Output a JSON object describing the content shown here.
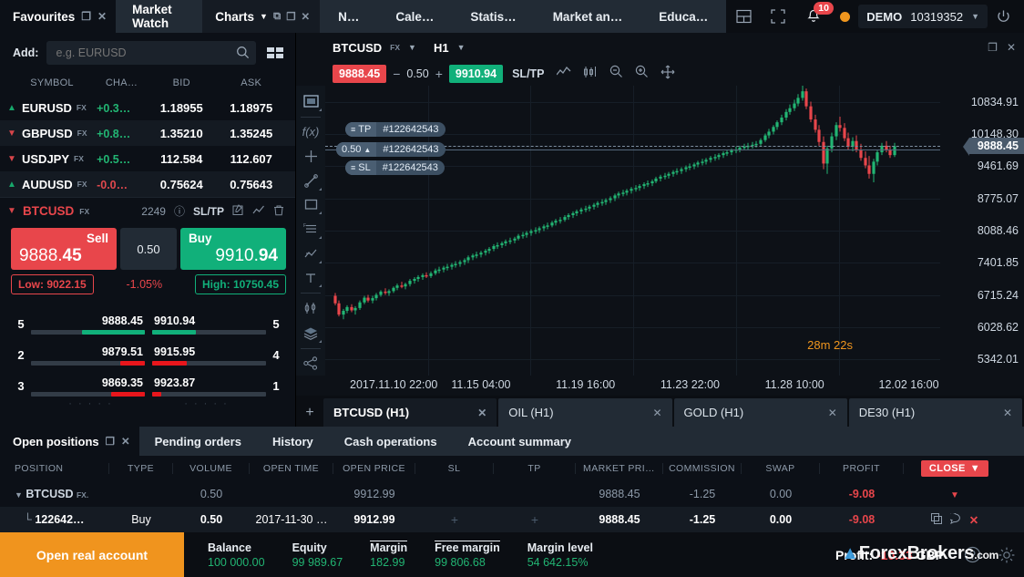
{
  "topbar": {
    "favourites_tab": "Favourites",
    "market_watch_tab": "Market Watch",
    "charts_tab": "Charts",
    "nav_tabs": [
      {
        "label": "N…"
      },
      {
        "label": "Cale…"
      },
      {
        "label": "Statis…"
      },
      {
        "label": "Market an…"
      },
      {
        "label": "Educa…"
      }
    ],
    "notification_count": "10",
    "account_type": "DEMO",
    "account_number": "10319352"
  },
  "watchlist": {
    "add_label": "Add:",
    "search_placeholder": "e.g. EURUSD",
    "columns": [
      "SYMBOL",
      "CHA…",
      "BID",
      "ASK"
    ],
    "rows": [
      {
        "dir": "up",
        "symbol": "EURUSD",
        "kind": "FX",
        "change": "+0.3…",
        "change_dir": "up",
        "bid": "1.18955",
        "ask": "1.18975"
      },
      {
        "dir": "down",
        "symbol": "GBPUSD",
        "kind": "FX",
        "change": "+0.8…",
        "change_dir": "up",
        "bid": "1.35210",
        "ask": "1.35245"
      },
      {
        "dir": "down",
        "symbol": "USDJPY",
        "kind": "FX",
        "change": "+0.5…",
        "change_dir": "up",
        "bid": "112.584",
        "ask": "112.607"
      },
      {
        "dir": "up",
        "symbol": "AUDUSD",
        "kind": "FX",
        "change": "-0.0…",
        "change_dir": "down",
        "bid": "0.75624",
        "ask": "0.75643"
      }
    ],
    "selected": {
      "symbol": "BTCUSD",
      "kind": "FX",
      "spread": "2249",
      "sltp": "SL/TP"
    }
  },
  "deal": {
    "sell_label": "Sell",
    "sell_price_main": "9888.",
    "sell_price_dec": "45",
    "volume": "0.50",
    "buy_label": "Buy",
    "buy_price_main": "9910.",
    "buy_price_dec": "94",
    "low": "Low: 9022.15",
    "change_pct": "-1.05%",
    "high": "High: 10750.45"
  },
  "depth": {
    "rows": [
      {
        "bid_qty": "5",
        "bid_price": "9888.45",
        "bid_pct": 55,
        "bid_color": "#11b07a",
        "ask_price": "9910.94",
        "ask_qty": "5",
        "ask_pct": 38,
        "ask_color": "#11b07a"
      },
      {
        "bid_qty": "2",
        "bid_price": "9879.51",
        "bid_pct": 22,
        "bid_color": "#e8161c",
        "ask_price": "9915.95",
        "ask_qty": "4",
        "ask_pct": 30,
        "ask_color": "#e8161c"
      },
      {
        "bid_qty": "3",
        "bid_price": "9869.35",
        "bid_pct": 30,
        "bid_color": "#e8161c",
        "ask_price": "9923.87",
        "ask_qty": "1",
        "ask_pct": 8,
        "ask_color": "#e8161c"
      }
    ]
  },
  "chart": {
    "symbol": "BTCUSD",
    "kind": "FX",
    "timeframe": "H1",
    "sell_price": "9888.45",
    "minus": "−",
    "volume": "0.50",
    "plus": "+",
    "buy_price": "9910.94",
    "sltp": "SL/TP",
    "countdown_m": "28m",
    "countdown_s": "22s",
    "countdown_m_unit": "m",
    "countdown_s_unit": "s",
    "position_tags": {
      "tp": "TP",
      "tp_id": "#122642543",
      "vol": "0.50",
      "vol_id": "#122642543",
      "sl": "SL",
      "sl_id": "#122642543"
    },
    "price_tag": "9888.45",
    "price_axis": [
      "10834.91",
      "10148.30",
      "9461.69",
      "8775.07",
      "8088.46",
      "7401.85",
      "6715.24",
      "6028.62",
      "5342.01"
    ],
    "time_axis": [
      "2017.11.10 22:00",
      "11.15 04:00",
      "11.19 16:00",
      "11.23 22:00",
      "11.28 10:00",
      "12.02 16:00"
    ],
    "tabs": [
      {
        "label": "BTCUSD (H1)",
        "active": true
      },
      {
        "label": "OIL (H1)",
        "active": false
      },
      {
        "label": "GOLD (H1)",
        "active": false
      },
      {
        "label": "DE30 (H1)",
        "active": false
      }
    ]
  },
  "chart_data": {
    "type": "candlestick",
    "title": "BTCUSD (H1)",
    "ylim": [
      5000,
      11180
    ],
    "up_color": "#22b573",
    "down_color": "#e8464b",
    "candles": [
      [
        0.01,
        6700,
        6760,
        6500,
        6540
      ],
      [
        0.017,
        6540,
        6600,
        6260,
        6300
      ],
      [
        0.024,
        6300,
        6420,
        6200,
        6380
      ],
      [
        0.031,
        6380,
        6500,
        6330,
        6460
      ],
      [
        0.038,
        6460,
        6520,
        6350,
        6390
      ],
      [
        0.045,
        6390,
        6480,
        6300,
        6440
      ],
      [
        0.052,
        6440,
        6600,
        6400,
        6560
      ],
      [
        0.059,
        6560,
        6700,
        6520,
        6660
      ],
      [
        0.066,
        6660,
        6720,
        6560,
        6600
      ],
      [
        0.073,
        6600,
        6700,
        6540,
        6650
      ],
      [
        0.08,
        6650,
        6760,
        6600,
        6720
      ],
      [
        0.087,
        6720,
        6820,
        6680,
        6790
      ],
      [
        0.094,
        6790,
        6860,
        6720,
        6760
      ],
      [
        0.101,
        6760,
        6840,
        6700,
        6800
      ],
      [
        0.108,
        6800,
        6900,
        6760,
        6870
      ],
      [
        0.115,
        6870,
        6960,
        6820,
        6920
      ],
      [
        0.122,
        6920,
        7000,
        6860,
        6900
      ],
      [
        0.129,
        6900,
        6980,
        6840,
        6950
      ],
      [
        0.136,
        6950,
        7060,
        6900,
        7020
      ],
      [
        0.143,
        7020,
        7100,
        6960,
        7060
      ],
      [
        0.15,
        7060,
        7140,
        7000,
        7100
      ],
      [
        0.157,
        7100,
        7180,
        7040,
        7140
      ],
      [
        0.164,
        7140,
        7200,
        7080,
        7120
      ],
      [
        0.171,
        7120,
        7220,
        7080,
        7180
      ],
      [
        0.178,
        7180,
        7280,
        7140,
        7240
      ],
      [
        0.185,
        7240,
        7320,
        7180,
        7260
      ],
      [
        0.192,
        7260,
        7340,
        7200,
        7300
      ],
      [
        0.199,
        7300,
        7380,
        7240,
        7320
      ],
      [
        0.206,
        7320,
        7400,
        7260,
        7360
      ],
      [
        0.213,
        7360,
        7440,
        7300,
        7380
      ],
      [
        0.22,
        7380,
        7460,
        7320,
        7420
      ],
      [
        0.227,
        7420,
        7500,
        7360,
        7460
      ],
      [
        0.234,
        7460,
        7560,
        7400,
        7520
      ],
      [
        0.241,
        7520,
        7600,
        7460,
        7560
      ],
      [
        0.248,
        7560,
        7640,
        7500,
        7580
      ],
      [
        0.255,
        7580,
        7660,
        7520,
        7620
      ],
      [
        0.262,
        7620,
        7700,
        7560,
        7660
      ],
      [
        0.269,
        7660,
        7740,
        7600,
        7700
      ],
      [
        0.276,
        7700,
        7800,
        7650,
        7760
      ],
      [
        0.283,
        7760,
        7840,
        7700,
        7780
      ],
      [
        0.29,
        7780,
        7860,
        7720,
        7820
      ],
      [
        0.297,
        7820,
        7900,
        7760,
        7860
      ],
      [
        0.304,
        7860,
        7940,
        7800,
        7880
      ],
      [
        0.311,
        7880,
        7960,
        7820,
        7920
      ],
      [
        0.318,
        7920,
        8020,
        7880,
        7980
      ],
      [
        0.325,
        7980,
        8060,
        7920,
        8000
      ],
      [
        0.332,
        8000,
        8080,
        7940,
        8040
      ],
      [
        0.339,
        8040,
        8120,
        7980,
        8080
      ],
      [
        0.346,
        8080,
        8160,
        8020,
        8100
      ],
      [
        0.353,
        8100,
        8180,
        8040,
        8140
      ],
      [
        0.36,
        8140,
        8220,
        8080,
        8180
      ],
      [
        0.367,
        8180,
        8260,
        8120,
        8200
      ],
      [
        0.374,
        8200,
        8300,
        8160,
        8260
      ],
      [
        0.381,
        8260,
        8340,
        8200,
        8300
      ],
      [
        0.388,
        8300,
        8380,
        8240,
        8320
      ],
      [
        0.395,
        8320,
        8420,
        8280,
        8380
      ],
      [
        0.402,
        8380,
        8460,
        8320,
        8420
      ],
      [
        0.409,
        8420,
        8500,
        8360,
        8460
      ],
      [
        0.416,
        8460,
        8540,
        8400,
        8500
      ],
      [
        0.423,
        8500,
        8580,
        8440,
        8540
      ],
      [
        0.43,
        8540,
        8620,
        8480,
        8560
      ],
      [
        0.437,
        8560,
        8640,
        8500,
        8600
      ],
      [
        0.444,
        8600,
        8680,
        8540,
        8640
      ],
      [
        0.451,
        8640,
        8720,
        8580,
        8680
      ],
      [
        0.458,
        8680,
        8760,
        8620,
        8700
      ],
      [
        0.465,
        8700,
        8780,
        8640,
        8740
      ],
      [
        0.472,
        8740,
        8820,
        8680,
        8780
      ],
      [
        0.479,
        8780,
        8880,
        8720,
        8840
      ],
      [
        0.486,
        8840,
        8920,
        8780,
        8880
      ],
      [
        0.493,
        8880,
        8960,
        8820,
        8900
      ],
      [
        0.5,
        8900,
        8980,
        8840,
        8940
      ],
      [
        0.507,
        8940,
        9020,
        8880,
        8980
      ],
      [
        0.514,
        8980,
        9060,
        8920,
        9000
      ],
      [
        0.521,
        9000,
        9080,
        8940,
        9040
      ],
      [
        0.528,
        9040,
        9120,
        8980,
        9080
      ],
      [
        0.535,
        9080,
        9160,
        9020,
        9100
      ],
      [
        0.542,
        9100,
        9180,
        9040,
        9140
      ],
      [
        0.549,
        9140,
        9240,
        9100,
        9200
      ],
      [
        0.556,
        9200,
        9280,
        9140,
        9240
      ],
      [
        0.563,
        9240,
        9320,
        9180,
        9260
      ],
      [
        0.57,
        9260,
        9340,
        9200,
        9300
      ],
      [
        0.577,
        9300,
        9380,
        9240,
        9340
      ],
      [
        0.584,
        9340,
        9420,
        9280,
        9360
      ],
      [
        0.591,
        9360,
        9440,
        9300,
        9400
      ],
      [
        0.598,
        9400,
        9480,
        9340,
        9440
      ],
      [
        0.605,
        9440,
        9520,
        9380,
        9460
      ],
      [
        0.612,
        9460,
        9540,
        9400,
        9500
      ],
      [
        0.619,
        9500,
        9580,
        9440,
        9540
      ],
      [
        0.626,
        9540,
        9620,
        9480,
        9560
      ],
      [
        0.633,
        9560,
        9640,
        9500,
        9600
      ],
      [
        0.64,
        9600,
        9680,
        9540,
        9640
      ],
      [
        0.647,
        9640,
        9720,
        9580,
        9660
      ],
      [
        0.654,
        9660,
        9740,
        9600,
        9700
      ],
      [
        0.661,
        9700,
        9780,
        9640,
        9740
      ],
      [
        0.668,
        9740,
        9820,
        9680,
        9760
      ],
      [
        0.675,
        9760,
        9840,
        9700,
        9800
      ],
      [
        0.682,
        9800,
        9880,
        9740,
        9820
      ],
      [
        0.689,
        9820,
        9900,
        9760,
        9860
      ],
      [
        0.696,
        9860,
        9940,
        9800,
        9880
      ],
      [
        0.703,
        9880,
        9960,
        9820,
        9900
      ],
      [
        0.71,
        9900,
        9980,
        9840,
        9920
      ],
      [
        0.717,
        9920,
        10000,
        9860,
        9940
      ],
      [
        0.724,
        9940,
        10060,
        9900,
        10020
      ],
      [
        0.731,
        10020,
        10160,
        9980,
        10120
      ],
      [
        0.738,
        10120,
        10260,
        10060,
        10200
      ],
      [
        0.745,
        10200,
        10340,
        10140,
        10300
      ],
      [
        0.752,
        10300,
        10440,
        10240,
        10400
      ],
      [
        0.759,
        10400,
        10560,
        10340,
        10500
      ],
      [
        0.766,
        10500,
        10680,
        10440,
        10620
      ],
      [
        0.773,
        10620,
        10780,
        10560,
        10700
      ],
      [
        0.78,
        10700,
        10880,
        10640,
        10800
      ],
      [
        0.787,
        10800,
        11000,
        10740,
        10920
      ],
      [
        0.794,
        10920,
        11180,
        10860,
        11060
      ],
      [
        0.801,
        11060,
        11120,
        10680,
        10740
      ],
      [
        0.808,
        10740,
        10840,
        10400,
        10460
      ],
      [
        0.815,
        10460,
        10560,
        10180,
        10240
      ],
      [
        0.822,
        10240,
        10340,
        9900,
        9980
      ],
      [
        0.829,
        9980,
        10100,
        9400,
        9520
      ],
      [
        0.836,
        9520,
        9900,
        9300,
        9840
      ],
      [
        0.843,
        9840,
        10180,
        9760,
        10100
      ],
      [
        0.85,
        10100,
        10400,
        10020,
        10340
      ],
      [
        0.857,
        10340,
        10520,
        10200,
        10280
      ],
      [
        0.864,
        10280,
        10380,
        10000,
        10060
      ],
      [
        0.871,
        10060,
        10180,
        9820,
        9880
      ],
      [
        0.878,
        9880,
        10080,
        9780,
        10000
      ],
      [
        0.885,
        10000,
        10120,
        9760,
        9820
      ],
      [
        0.892,
        9820,
        9940,
        9580,
        9640
      ],
      [
        0.899,
        9640,
        9780,
        9420,
        9480
      ],
      [
        0.906,
        9480,
        9680,
        9200,
        9300
      ],
      [
        0.913,
        9300,
        9620,
        9120,
        9560
      ],
      [
        0.92,
        9560,
        9820,
        9480,
        9760
      ],
      [
        0.927,
        9760,
        9960,
        9700,
        9900
      ],
      [
        0.934,
        9900,
        10000,
        9760,
        9810
      ],
      [
        0.941,
        9810,
        9900,
        9640,
        9700
      ],
      [
        0.948,
        9700,
        9960,
        9660,
        9888
      ]
    ]
  },
  "positions": {
    "tabs": [
      {
        "label": "Open positions",
        "active": true
      },
      {
        "label": "Pending orders",
        "active": false
      },
      {
        "label": "History",
        "active": false
      },
      {
        "label": "Cash operations",
        "active": false
      },
      {
        "label": "Account summary",
        "active": false
      }
    ],
    "columns": [
      "POSITION",
      "TYPE",
      "VOLUME",
      "OPEN TIME",
      "OPEN PRICE",
      "SL",
      "TP",
      "MARKET PRI…",
      "COMMISSION",
      "SWAP",
      "PROFIT"
    ],
    "close_label": "CLOSE",
    "group_row": {
      "symbol": "BTCUSD",
      "kind": "FX.",
      "volume": "0.50",
      "open_price": "9912.99",
      "market_price": "9888.45",
      "commission": "-1.25",
      "swap": "0.00",
      "profit": "-9.08"
    },
    "position_row": {
      "id": "122642…",
      "type": "Buy",
      "volume": "0.50",
      "open_time": "2017-11-30 …",
      "open_price": "9912.99",
      "sl": "+",
      "tp": "+",
      "market_price": "9888.45",
      "commission": "-1.25",
      "swap": "0.00",
      "profit": "-9.08"
    }
  },
  "status": {
    "open_real_account": "Open real account",
    "balance_label": "Balance",
    "balance_value": "100 000.00",
    "equity_label": "Equity",
    "equity_value": "99 989.67",
    "margin_label": "Margin",
    "margin_value": "182.99",
    "free_margin_label": "Free margin",
    "free_margin_value": "99 806.68",
    "margin_level_label": "Margin level",
    "margin_level_value": "54 642.15%",
    "profit_label": "Profit:",
    "profit_value": "-10.33",
    "profit_currency": "GBP"
  },
  "watermark": {
    "text": "ForexBrokers",
    "suffix": ".com"
  }
}
